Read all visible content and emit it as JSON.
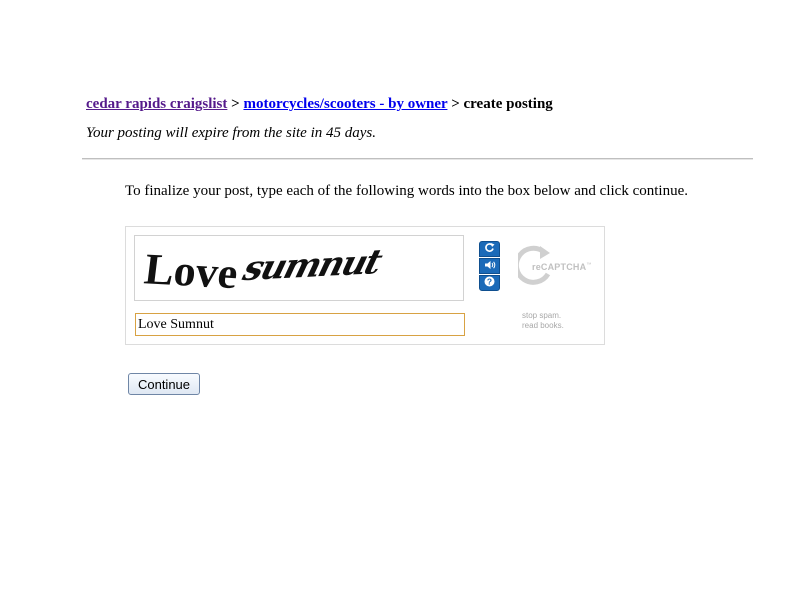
{
  "breadcrumb": {
    "site_link": "cedar rapids craigslist",
    "separator": ">",
    "category_link": "motorcycles/scooters - by owner",
    "current": "create posting"
  },
  "expire_note": "Your posting will expire from the site in 45 days.",
  "instructions": "To finalize your post, type each of the following words into the box below and click continue.",
  "captcha": {
    "challenge_word_1": "Love",
    "challenge_word_2": "sumnut",
    "input_value": "Love Sumnut",
    "controls": [
      {
        "name": "refresh-icon"
      },
      {
        "name": "audio-icon"
      },
      {
        "name": "help-icon"
      }
    ],
    "logo_text": "reCAPTCHA",
    "logo_tm": "™",
    "tagline_line1": "stop spam.",
    "tagline_line2": "read books.",
    "accent_color": "#1b6ab8",
    "input_border_color": "#d8a243"
  },
  "continue_label": "Continue",
  "colors": {
    "visited_link": "#551a8b",
    "link": "#0000ee"
  }
}
